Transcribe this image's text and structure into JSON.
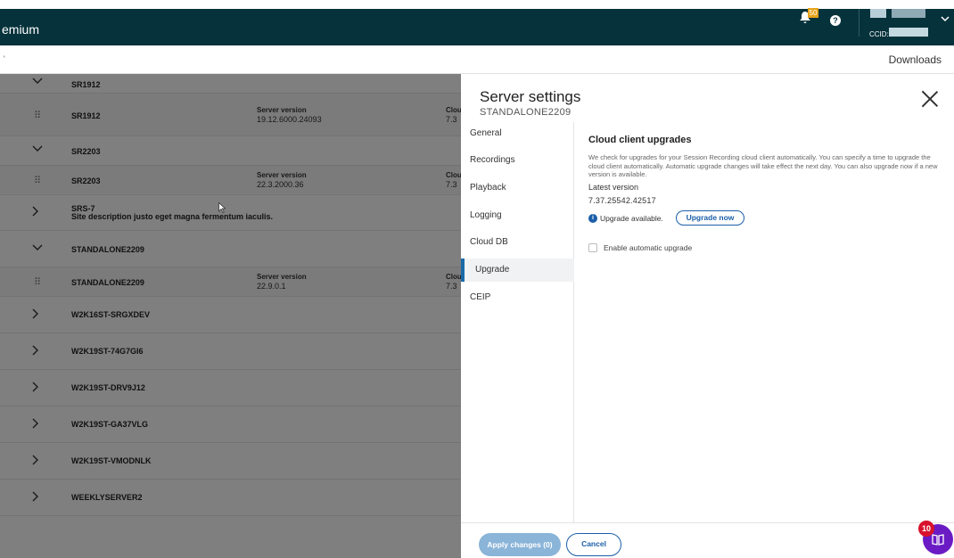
{
  "header": {
    "brand": "emium",
    "notif_count": "50",
    "help_glyph": "?",
    "ccid_label": "CCID:"
  },
  "subbar": {
    "downloads": "Downloads"
  },
  "list": {
    "rows": [
      {
        "kind": "group",
        "name": "SR1912"
      },
      {
        "kind": "child",
        "name": "SR1912",
        "sv_label": "Server version",
        "sv_value": "19.12.6000.24093",
        "cl_label": "Clou",
        "cl_value": "7.3"
      },
      {
        "kind": "group",
        "name": "SR2203"
      },
      {
        "kind": "child",
        "name": "SR2203",
        "sv_label": "Server version",
        "sv_value": "22.3.2000.36",
        "cl_label": "Clou",
        "cl_value": "7.3"
      },
      {
        "kind": "collapsed",
        "name": "SRS-7",
        "desc": "Site description justo eget magna fermentum iaculis."
      },
      {
        "kind": "group",
        "name": "STANDALONE2209"
      },
      {
        "kind": "child",
        "name": "STANDALONE2209",
        "sv_label": "Server version",
        "sv_value": "22.9.0.1",
        "cl_label": "Clou",
        "cl_value": "7.3"
      },
      {
        "kind": "collapsed",
        "name": "W2K16ST-SRGXDEV"
      },
      {
        "kind": "collapsed",
        "name": "W2K19ST-74G7GI6"
      },
      {
        "kind": "collapsed",
        "name": "W2K19ST-DRV9J12"
      },
      {
        "kind": "collapsed",
        "name": "W2K19ST-GA37VLG"
      },
      {
        "kind": "collapsed",
        "name": "W2K19ST-VMODNLK"
      },
      {
        "kind": "collapsed",
        "name": "WEEKLYSERVER2"
      }
    ]
  },
  "panel": {
    "title": "Server settings",
    "subtitle": "STANDALONE2209",
    "nav": [
      "General",
      "Recordings",
      "Playback",
      "Logging",
      "Cloud DB",
      "Upgrade",
      "CEIP"
    ],
    "active_nav": "Upgrade",
    "section_title": "Cloud client upgrades",
    "section_desc": "We check for upgrades for your Session Recording cloud client automatically. You can specify a time to upgrade the cloud client automatically. Automatic upgrade changes will take effect the next day. You can also upgrade now if a new version is available.",
    "latest_label": "Latest version",
    "latest_value": "7.37.25542.42517",
    "upgrade_available": "Upgrade available.",
    "upgrade_now": "Upgrade now",
    "auto_upgrade_label": "Enable automatic upgrade",
    "auto_upgrade_checked": false,
    "apply_label": "Apply changes (0)",
    "cancel_label": "Cancel"
  },
  "help_fab": {
    "badge": "10"
  },
  "colors": {
    "topbar": "#05323b",
    "accent": "#1a5fa8",
    "fab": "#6a1bc4",
    "badge": "#d8122c"
  }
}
